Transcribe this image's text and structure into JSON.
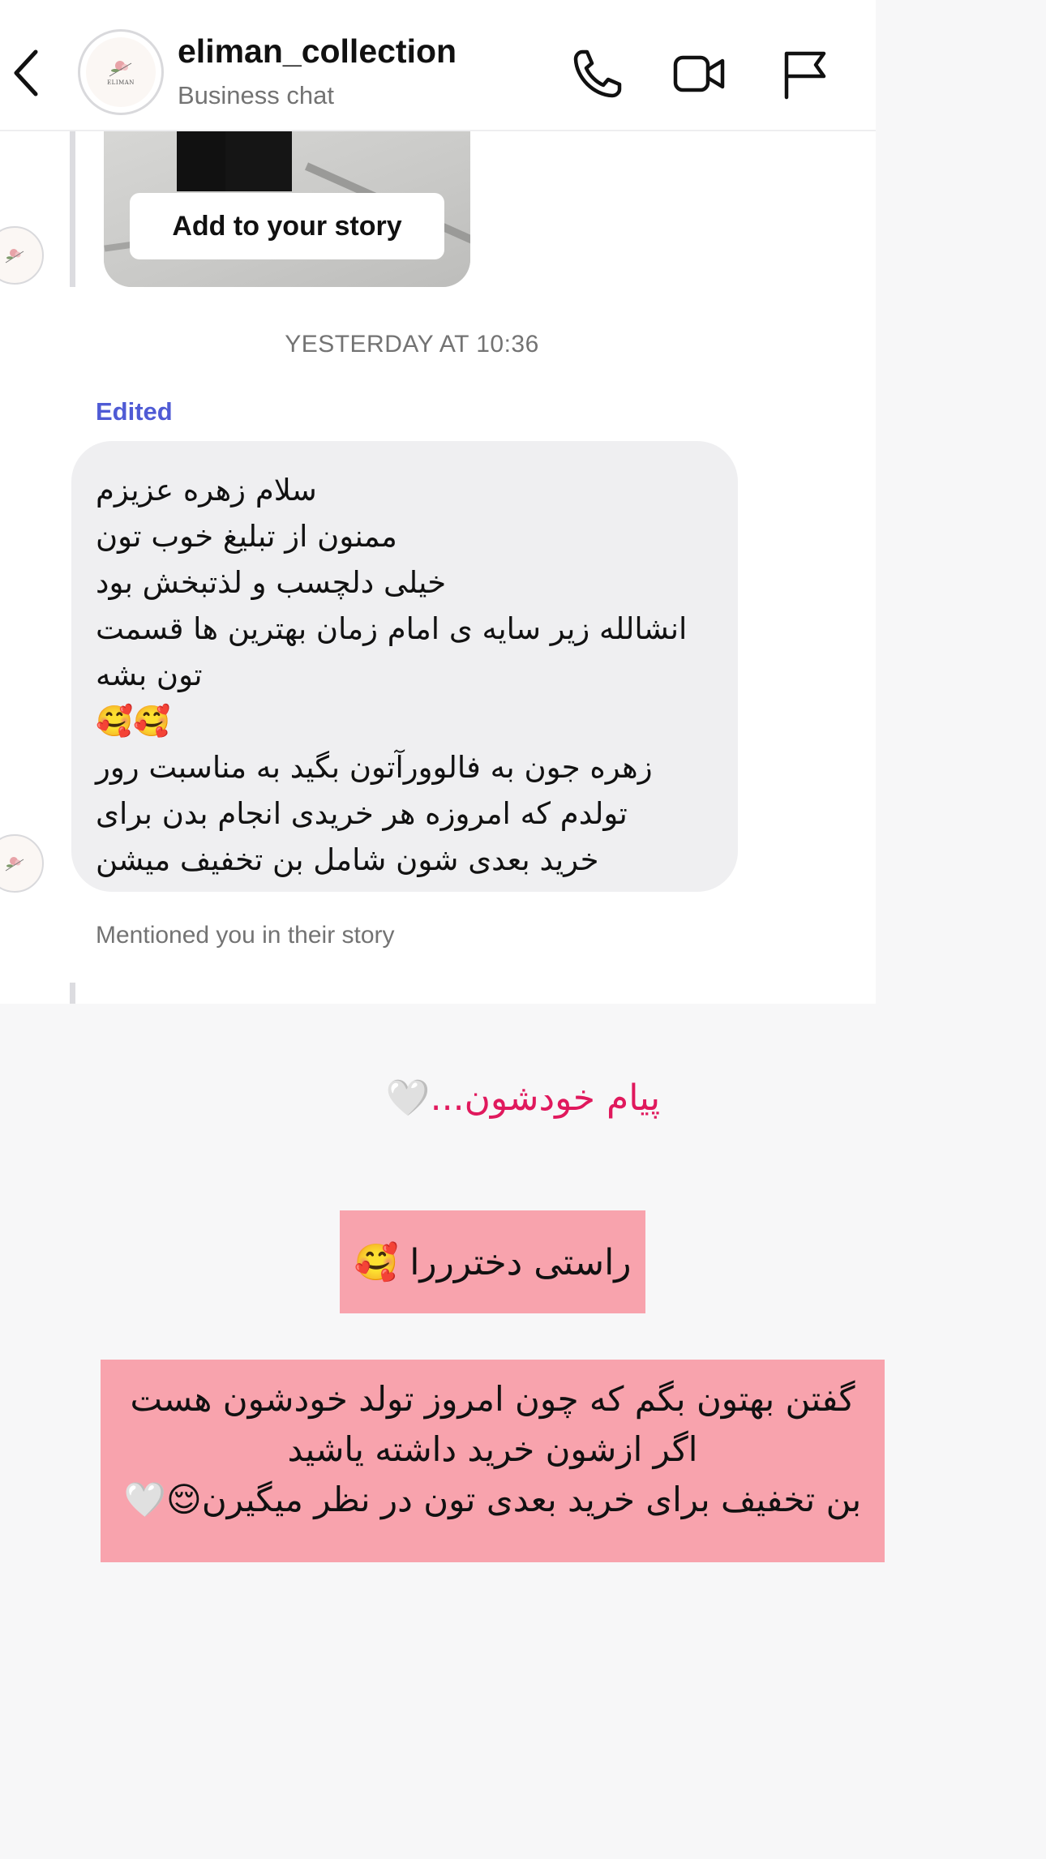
{
  "header": {
    "username": "eliman_collection",
    "subtitle": "Business chat",
    "avatar_brand": "ELIMAN",
    "icons": [
      "back-chevron-icon",
      "phone-icon",
      "video-camera-icon",
      "flag-icon"
    ]
  },
  "story_preview": {
    "button_label": "Add to your story"
  },
  "timestamp": "YESTERDAY AT 10:36",
  "message": {
    "edited_label": "Edited",
    "lines": [
      "سلام زهره عزیزم",
      "ممنون از تبلیغ خوب تون",
      "خیلی دلچسب و لذتبخش بود",
      "انشالله زیر سایه ی امام زمان بهترین ها قسمت",
      "تون بشه",
      "🥰🥰",
      "زهره جون به فالوورآتون بگید به مناسبت رور",
      "تولدم که امروزه هر خریدی انجام بدن برای",
      "خرید بعدی شون شامل بن تخفیف میشن"
    ]
  },
  "mention_label": "Mentioned you in their story",
  "story_overlay": {
    "caption": "پیام خودشون...🤍",
    "sticker_1": "راستی دخترررا 🥰",
    "sticker_2_lines": [
      "گفتن بهتون بگم که چون امروز تولد خودشون هست",
      "اگر ازشون خرید داشته یاشید",
      "بن  تخفیف برای خرید بعدی تون در نظر میگیرن😌🤍"
    ]
  },
  "colors": {
    "edited": "#4f5bd5",
    "bubble": "#efeff1",
    "caption_pink": "#e0195d",
    "sticker_bg": "#f8a3ad",
    "muted_text": "#737373"
  }
}
